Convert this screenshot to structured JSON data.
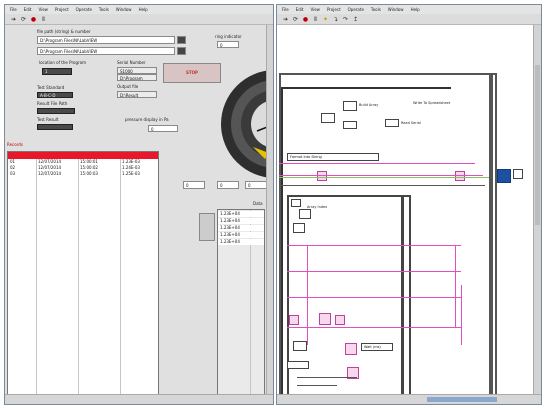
{
  "front_panel": {
    "menu": [
      "File",
      "Edit",
      "View",
      "Project",
      "Operate",
      "Tools",
      "Window",
      "Help"
    ],
    "toolbar_icons": [
      "run-arrow-icon",
      "run-continuous-icon",
      "abort-icon",
      "pause-icon"
    ],
    "file_group_label": "file path (string) & number",
    "path_1": "D:\\Program Files\\NI\\LabVIEW",
    "path_2": "D:\\Program Files\\NI\\LabVIEW",
    "small_label_top_right": "ring indicator",
    "small_value_top_right": "0",
    "mid_left_label": "location of the Program",
    "mid_left_value": "1",
    "mid_mid_label": "Serial Number",
    "mid_mid_value_1": "S1000",
    "mid_mid_value_2": "D:\\Program",
    "mid_mid_label_2": "Output file",
    "mid_mid_value_3": "D:\\Result",
    "stop_button": "STOP",
    "left_fields_label": "Test Standard",
    "left_field_1": "A-B-C-D",
    "left_field_2": "Result File Path",
    "left_field_3": "Test Result",
    "gauge_label": "pressure display in Pa",
    "gauge_value": "0",
    "table_label": "Records",
    "table_rows": [
      [
        "01",
        "12/07/2014",
        "15:00:01",
        "1.23E-03"
      ],
      [
        "02",
        "12/07/2014",
        "15:00:02",
        "1.24E-03"
      ],
      [
        "03",
        "12/07/2014",
        "15:00:03",
        "1.25E-03"
      ]
    ],
    "right_small_fields": [
      "0",
      "0",
      "0"
    ],
    "right_table_label": "Data",
    "right_table_rows": [
      "1.23E+04",
      "1.23E+04",
      "1.23E+04",
      "1.23E+04",
      "1.23E+04"
    ]
  },
  "block_diagram": {
    "menu": [
      "File",
      "Edit",
      "View",
      "Project",
      "Operate",
      "Tools",
      "Window",
      "Help"
    ],
    "toolbar_icons": [
      "run-arrow-icon",
      "run-continuous-icon",
      "abort-icon",
      "pause-icon",
      "highlight-icon",
      "step-into-icon",
      "step-over-icon",
      "step-out-icon"
    ],
    "node_labels": [
      "Write To Spreadsheet",
      "Array Index",
      "Build Array",
      "Read Serial",
      "Format Into String",
      "Wait (ms)"
    ]
  },
  "colors": {
    "accent_red": "#e8182a",
    "wire_pink": "#e050c0",
    "panel_gray": "#e0e0e0",
    "gauge_yellow": "#e6c200"
  }
}
